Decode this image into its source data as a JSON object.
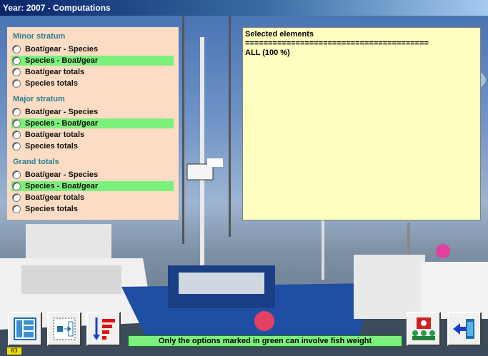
{
  "window": {
    "title": "Year: 2007 - Computations"
  },
  "options": {
    "groups": [
      {
        "header": "Minor stratum",
        "items": [
          {
            "label": "Boat/gear - Species",
            "green": false
          },
          {
            "label": "Species - Boat/gear",
            "green": true
          },
          {
            "label": "Boat/gear totals",
            "green": false
          },
          {
            "label": "Species totals",
            "green": false
          }
        ]
      },
      {
        "header": "Major stratum",
        "items": [
          {
            "label": "Boat/gear - Species",
            "green": false
          },
          {
            "label": "Species - Boat/gear",
            "green": true
          },
          {
            "label": "Boat/gear totals",
            "green": false
          },
          {
            "label": "Species totals",
            "green": false
          }
        ]
      },
      {
        "header": "Grand totals",
        "items": [
          {
            "label": "Boat/gear - Species",
            "green": false
          },
          {
            "label": "Species - Boat/gear",
            "green": true
          },
          {
            "label": "Boat/gear totals",
            "green": false
          },
          {
            "label": "Species totals",
            "green": false
          }
        ]
      }
    ]
  },
  "selected": {
    "title": "Selected elements",
    "separator": "========================================",
    "value": "ALL (100 %)"
  },
  "toolbar": {
    "note": "Only the options marked in green can involve fish weight",
    "buttons": [
      {
        "icon": "table-layout-icon"
      },
      {
        "icon": "column-select-icon"
      },
      {
        "icon": "sort-descending-icon"
      },
      {
        "icon": "group-presentation-icon"
      },
      {
        "icon": "exit-door-icon"
      }
    ]
  },
  "status": {
    "page_indicator": "03"
  },
  "colors": {
    "green_option": "#7cf07c",
    "panel_bg": "#fcdcc4",
    "selected_bg": "#ffffc0",
    "header_text": "#2a7f8f"
  }
}
